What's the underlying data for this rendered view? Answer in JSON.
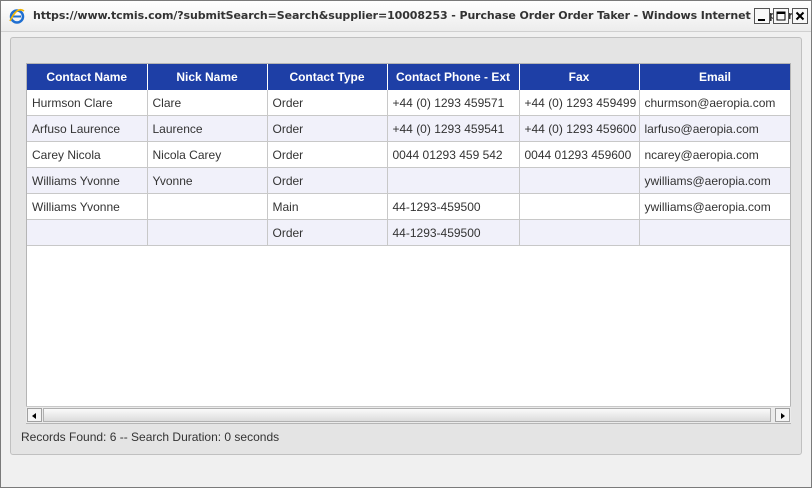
{
  "window": {
    "title": "https://www.tcmis.com/?submitSearch=Search&supplier=10008253 - Purchase Order Order Taker - Windows Internet Explorer",
    "controls": [
      "minimize",
      "maximize",
      "close"
    ]
  },
  "table": {
    "columns": [
      "Contact Name",
      "Nick Name",
      "Contact Type",
      "Contact Phone - Ext",
      "Fax",
      "Email"
    ],
    "rows": [
      [
        "Hurmson Clare",
        "Clare",
        "Order",
        "+44 (0) 1293 459571",
        "+44 (0) 1293 459499",
        "churmson@aeropia.com"
      ],
      [
        "Arfuso Laurence",
        "Laurence",
        "Order",
        "+44 (0) 1293 459541",
        "+44 (0) 1293 459600",
        "larfuso@aeropia.com"
      ],
      [
        "Carey Nicola",
        "Nicola Carey",
        "Order",
        "0044 01293 459 542",
        "0044 01293 459600",
        "ncarey@aeropia.com"
      ],
      [
        "Williams Yvonne",
        "Yvonne",
        "Order",
        "",
        "",
        "ywilliams@aeropia.com"
      ],
      [
        "Williams Yvonne",
        "",
        "Main",
        "44-1293-459500",
        "",
        "ywilliams@aeropia.com"
      ],
      [
        "",
        "",
        "Order",
        "44-1293-459500",
        "",
        ""
      ]
    ]
  },
  "status": "Records Found: 6 -- Search Duration: 0 seconds",
  "colors": {
    "header_bg": "#1e3fa6",
    "header_text": "#ffffff",
    "alt_row_bg": "#f1f1fa",
    "grid_line": "#c8c8c8"
  }
}
